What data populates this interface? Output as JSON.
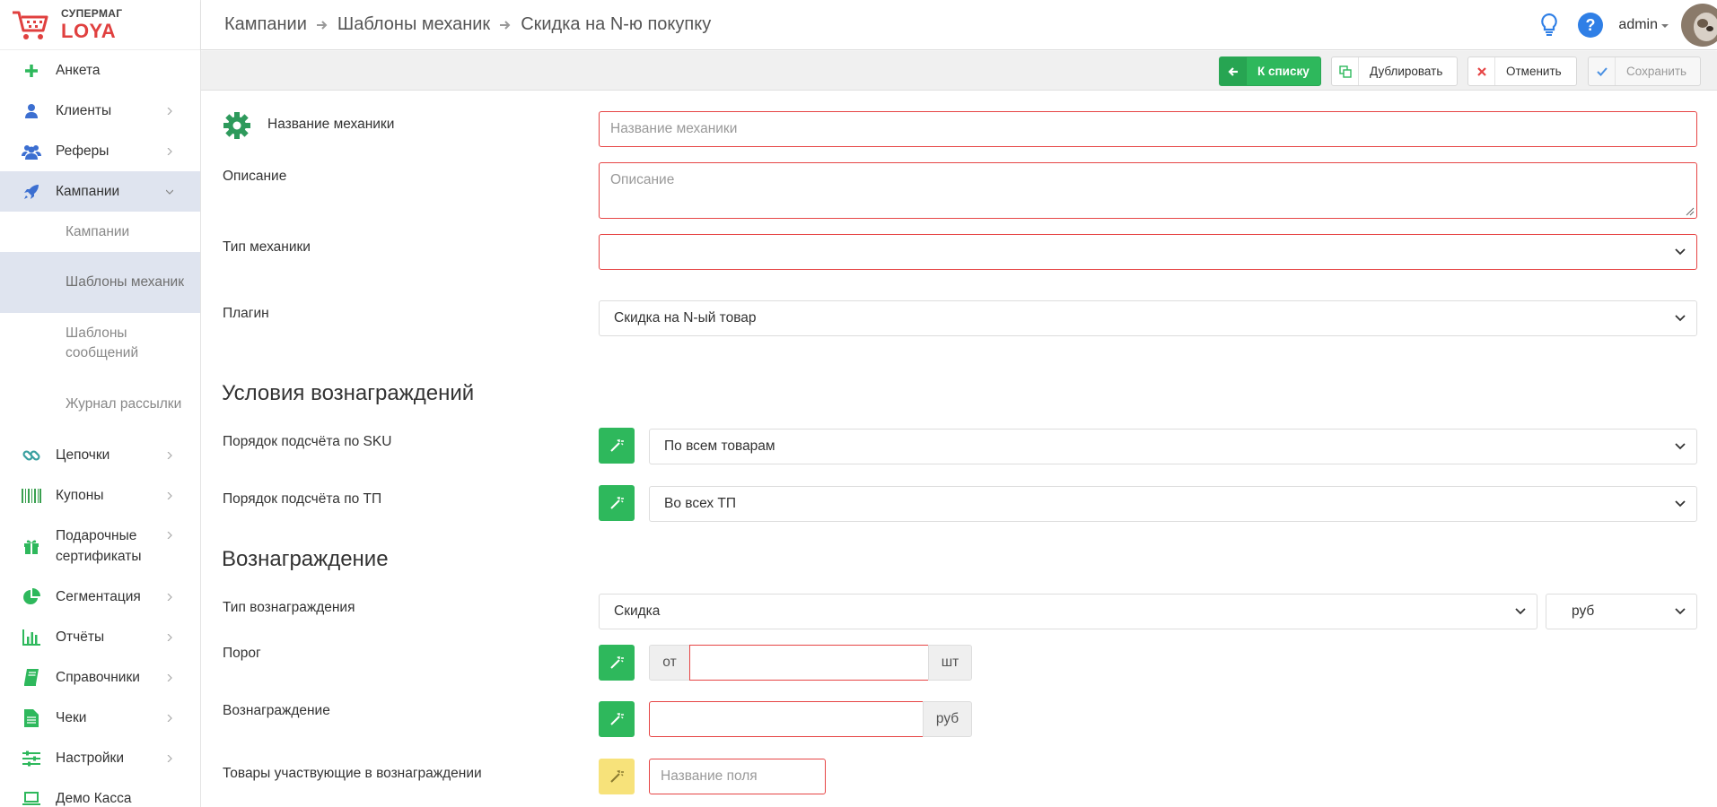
{
  "logo": {
    "line1": "СУПЕРМАГ",
    "line2": "LOYA"
  },
  "sidebar": {
    "items": [
      {
        "label": "Анкета"
      },
      {
        "label": "Клиенты"
      },
      {
        "label": "Реферы"
      },
      {
        "label": "Кампании"
      },
      {
        "label": "Цепочки"
      },
      {
        "label": "Купоны"
      },
      {
        "label": "Подарочные сертификаты"
      },
      {
        "label": "Сегментация"
      },
      {
        "label": "Отчёты"
      },
      {
        "label": "Справочники"
      },
      {
        "label": "Чеки"
      },
      {
        "label": "Настройки"
      },
      {
        "label": "Демо Касса"
      }
    ],
    "sub": [
      {
        "label": "Кампании"
      },
      {
        "label": "Шаблоны механик"
      },
      {
        "label": "Шаблоны сообщений"
      },
      {
        "label": "Журнал рассылки"
      }
    ]
  },
  "breadcrumb": [
    "Кампании",
    "Шаблоны механик",
    "Скидка на N-ю покупку"
  ],
  "header": {
    "user": "admin"
  },
  "toolbar": {
    "back": "К списку",
    "duplicate": "Дублировать",
    "cancel": "Отменить",
    "save": "Сохранить"
  },
  "form": {
    "name_label": "Название механики",
    "name_placeholder": "Название механики",
    "desc_label": "Описание",
    "desc_placeholder": "Описание",
    "type_label": "Тип механики",
    "type_value": "",
    "plugin_label": "Плагин",
    "plugin_value": "Скидка на N-ый товар"
  },
  "conditions": {
    "title": "Условия вознаграждений",
    "sku_label": "Порядок подсчёта по SKU",
    "sku_value": "По всем товарам",
    "tp_label": "Порядок подсчёта по ТП",
    "tp_value": "Во всех ТП"
  },
  "reward": {
    "title": "Вознаграждение",
    "type_label": "Тип вознаграждения",
    "type_value": "Скидка",
    "currency_value": "руб",
    "threshold_label": "Порог",
    "threshold_prefix": "от",
    "threshold_suffix": "шт",
    "threshold_value": "",
    "amount_label": "Вознаграждение",
    "amount_suffix": "руб",
    "amount_value": "",
    "goods_label": "Товары участвующие в вознаграждении",
    "goods_placeholder": "Название поля"
  },
  "colors": {
    "accent_green": "#2eb85c",
    "error_red": "#e64545",
    "active_bg": "#dfe4ef",
    "wand_yellow": "#f7e27a",
    "help_blue": "#2f7fe6"
  }
}
